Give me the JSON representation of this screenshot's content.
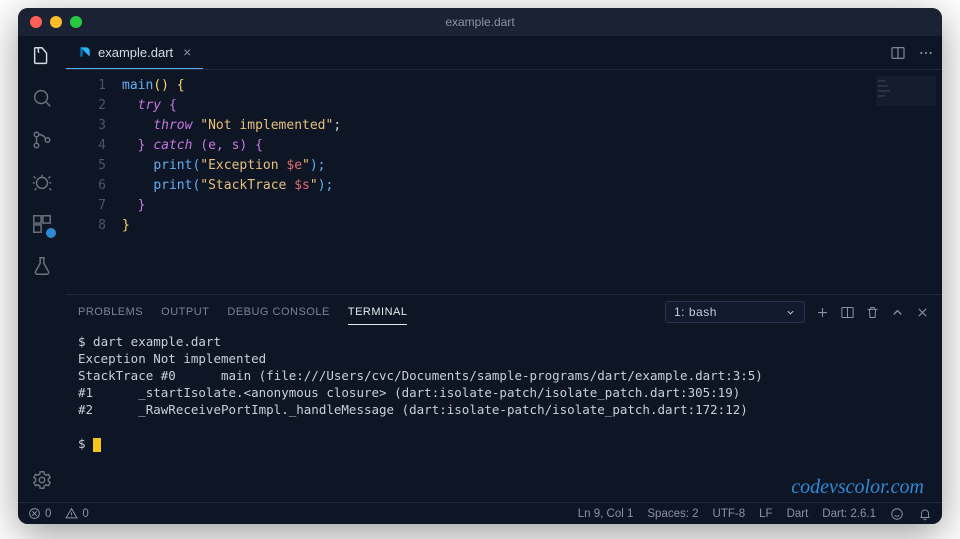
{
  "window_title": "example.dart",
  "tab": {
    "filename": "example.dart"
  },
  "code": {
    "lines": [
      1,
      2,
      3,
      4,
      5,
      6,
      7,
      8
    ],
    "l1_fn": "main",
    "l1_rest": "() {",
    "l2_kw": "try",
    "l2_rest": " {",
    "l3_kw": "throw",
    "l3_str": "\"Not implemented\"",
    "l3_end": ";",
    "l4_a": "} ",
    "l4_kw": "catch",
    "l4_b": " (e, s) {",
    "l5_fn": "print",
    "l5_a": "(",
    "l5_str": "\"Exception ",
    "l5_var": "$e",
    "l5_strend": "\"",
    "l5_b": ");",
    "l6_fn": "print",
    "l6_a": "(",
    "l6_str": "\"StackTrace ",
    "l6_var": "$s",
    "l6_strend": "\"",
    "l6_b": ");",
    "l7": "}",
    "l8": "}"
  },
  "panel": {
    "tabs": {
      "problems": "PROBLEMS",
      "output": "OUTPUT",
      "debug": "DEBUG CONSOLE",
      "terminal": "TERMINAL"
    },
    "terminal_selector": "1: bash"
  },
  "terminal": {
    "cmd": "$ dart example.dart",
    "out1": "Exception Not implemented",
    "out2": "StackTrace #0      main (file:///Users/cvc/Documents/sample-programs/dart/example.dart:3:5)",
    "out3": "#1      _startIsolate.<anonymous closure> (dart:isolate-patch/isolate_patch.dart:305:19)",
    "out4": "#2      _RawReceivePortImpl._handleMessage (dart:isolate-patch/isolate_patch.dart:172:12)",
    "prompt": "$ "
  },
  "status": {
    "errors": "0",
    "warnings": "0",
    "lncol": "Ln 9, Col 1",
    "spaces": "Spaces: 2",
    "encoding": "UTF-8",
    "eol": "LF",
    "lang": "Dart",
    "sdk": "Dart: 2.6.1"
  },
  "watermark": "codevscolor.com"
}
